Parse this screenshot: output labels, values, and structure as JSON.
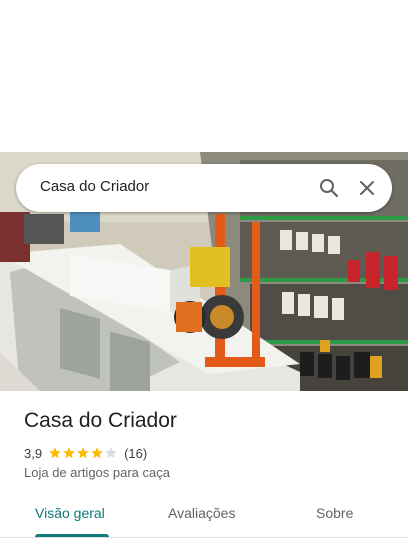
{
  "search": {
    "query": "Casa do Criador"
  },
  "place": {
    "name": "Casa do Criador",
    "rating": "3,9",
    "rating_value": 3.9,
    "stars_max": 5,
    "review_count": "(16)",
    "category": "Loja de artigos para caça"
  },
  "tabs": [
    {
      "label": "Visão geral",
      "active": true
    },
    {
      "label": "Avaliações",
      "active": false
    },
    {
      "label": "Sobre",
      "active": false
    }
  ],
  "colors": {
    "star": "#fbbc04",
    "star_empty": "#dadce0",
    "tab_active": "#0b7a78"
  },
  "icons": [
    "search-icon",
    "close-icon",
    "star-icon"
  ]
}
